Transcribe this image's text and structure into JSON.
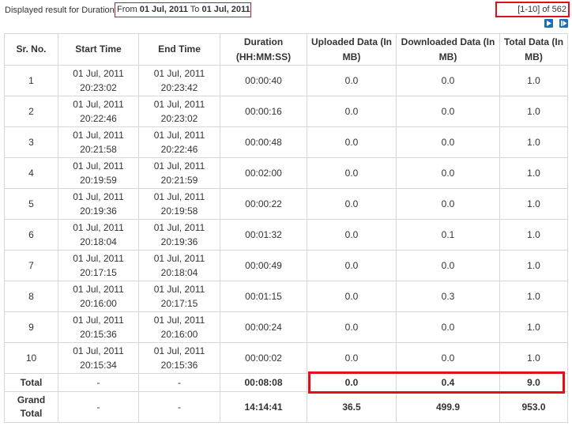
{
  "header": {
    "caption": "Displayed result for Duration",
    "range_from_label": "From",
    "range_from_date": "01 Jul, 2011",
    "range_to_label": "To",
    "range_to_date": "01 Jul, 2011",
    "pager_text": "[1-10] of 562",
    "next_icon": "next-page-icon",
    "last_icon": "last-page-icon",
    "highlight_color": "#e0101a",
    "nav_color": "#1a6fb5"
  },
  "table": {
    "columns": [
      "Sr. No.",
      "Start Time",
      "End Time",
      "Duration (HH:MM:SS)",
      "Uploaded Data (In MB)",
      "Downloaded Data (In MB)",
      "Total Data (In MB)"
    ],
    "rows": [
      {
        "sr": "1",
        "start_date": "01 Jul, 2011",
        "start_time": "20:23:02",
        "end_date": "01 Jul, 2011",
        "end_time": "20:23:42",
        "duration": "00:00:40",
        "uploaded": "0.0",
        "downloaded": "0.0",
        "total": "1.0"
      },
      {
        "sr": "2",
        "start_date": "01 Jul, 2011",
        "start_time": "20:22:46",
        "end_date": "01 Jul, 2011",
        "end_time": "20:23:02",
        "duration": "00:00:16",
        "uploaded": "0.0",
        "downloaded": "0.0",
        "total": "1.0"
      },
      {
        "sr": "3",
        "start_date": "01 Jul, 2011",
        "start_time": "20:21:58",
        "end_date": "01 Jul, 2011",
        "end_time": "20:22:46",
        "duration": "00:00:48",
        "uploaded": "0.0",
        "downloaded": "0.0",
        "total": "1.0"
      },
      {
        "sr": "4",
        "start_date": "01 Jul, 2011",
        "start_time": "20:19:59",
        "end_date": "01 Jul, 2011",
        "end_time": "20:21:59",
        "duration": "00:02:00",
        "uploaded": "0.0",
        "downloaded": "0.0",
        "total": "1.0"
      },
      {
        "sr": "5",
        "start_date": "01 Jul, 2011",
        "start_time": "20:19:36",
        "end_date": "01 Jul, 2011",
        "end_time": "20:19:58",
        "duration": "00:00:22",
        "uploaded": "0.0",
        "downloaded": "0.0",
        "total": "1.0"
      },
      {
        "sr": "6",
        "start_date": "01 Jul, 2011",
        "start_time": "20:18:04",
        "end_date": "01 Jul, 2011",
        "end_time": "20:19:36",
        "duration": "00:01:32",
        "uploaded": "0.0",
        "downloaded": "0.1",
        "total": "1.0"
      },
      {
        "sr": "7",
        "start_date": "01 Jul, 2011",
        "start_time": "20:17:15",
        "end_date": "01 Jul, 2011",
        "end_time": "20:18:04",
        "duration": "00:00:49",
        "uploaded": "0.0",
        "downloaded": "0.0",
        "total": "1.0"
      },
      {
        "sr": "8",
        "start_date": "01 Jul, 2011",
        "start_time": "20:16:00",
        "end_date": "01 Jul, 2011",
        "end_time": "20:17:15",
        "duration": "00:01:15",
        "uploaded": "0.0",
        "downloaded": "0.3",
        "total": "1.0"
      },
      {
        "sr": "9",
        "start_date": "01 Jul, 2011",
        "start_time": "20:15:36",
        "end_date": "01 Jul, 2011",
        "end_time": "20:16:00",
        "duration": "00:00:24",
        "uploaded": "0.0",
        "downloaded": "0.0",
        "total": "1.0"
      },
      {
        "sr": "10",
        "start_date": "01 Jul, 2011",
        "start_time": "20:15:34",
        "end_date": "01 Jul, 2011",
        "end_time": "20:15:36",
        "duration": "00:00:02",
        "uploaded": "0.0",
        "downloaded": "0.0",
        "total": "1.0"
      }
    ],
    "total": {
      "label": "Total",
      "start": "-",
      "end": "-",
      "duration": "00:08:08",
      "uploaded": "0.0",
      "downloaded": "0.4",
      "total": "9.0"
    },
    "grand_total": {
      "label_line1": "Grand",
      "label_line2": "Total",
      "start": "-",
      "end": "-",
      "duration": "14:14:41",
      "uploaded": "36.5",
      "downloaded": "499.9",
      "total": "953.0"
    }
  }
}
